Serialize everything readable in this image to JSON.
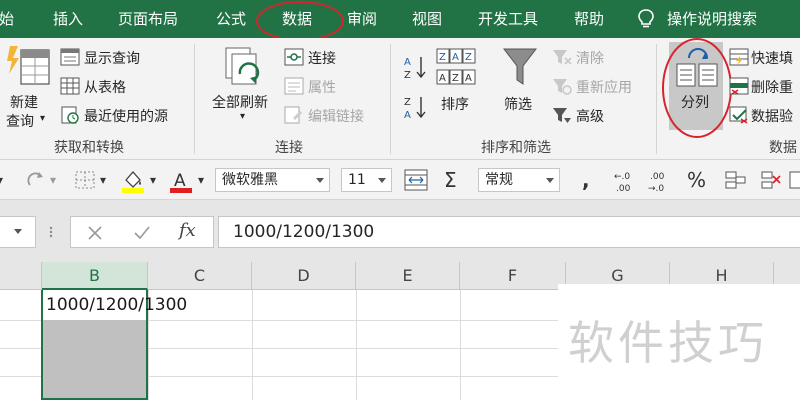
{
  "tabs": [
    {
      "label": "开始",
      "visible_text": "开始"
    },
    {
      "label": "插入"
    },
    {
      "label": "页面布局"
    },
    {
      "label": "公式"
    },
    {
      "label": "数据"
    },
    {
      "label": "审阅"
    },
    {
      "label": "视图"
    },
    {
      "label": "开发工具"
    },
    {
      "label": "帮助"
    }
  ],
  "tell_me": "操作说明搜索",
  "ribbon": {
    "get_transform": {
      "new_query_line1": "新建",
      "new_query_line2": "查询",
      "show_queries": "显示查询",
      "from_table": "从表格",
      "recent_sources": "最近使用的源",
      "group_label": "获取和转换"
    },
    "connections": {
      "refresh_all": "全部刷新",
      "connections": "连接",
      "properties": "属性",
      "edit_links": "编辑链接",
      "group_label": "连接"
    },
    "sort_filter": {
      "sort": "排序",
      "filter": "筛选",
      "clear": "清除",
      "reapply": "重新应用",
      "advanced": "高级",
      "group_label": "排序和筛选"
    },
    "data_tools": {
      "text_to_columns": "分列",
      "flash_fill": "快速填",
      "remove_duplicates": "删除重",
      "data_validation": "数据验",
      "group_label": "数据"
    }
  },
  "quick_toolbar": {
    "font_name": "微软雅黑",
    "font_size": "11",
    "number_format": "常规",
    "increase_decimal": "←.0\n.00",
    "decrease_decimal": ".00\n→.0",
    "percent": "%",
    "comma": ",",
    "sum": "Σ"
  },
  "formula_bar": {
    "fx_label": "fx",
    "value": "1000/1200/1300"
  },
  "grid": {
    "columns": [
      "B",
      "C",
      "D",
      "E",
      "F",
      "G",
      "H"
    ],
    "selected_column": "B",
    "cell_b1": "1000/1200/1300"
  },
  "watermark": "软件技巧",
  "colors": {
    "accent": "#217346",
    "highlight_circle": "#d7242c"
  }
}
